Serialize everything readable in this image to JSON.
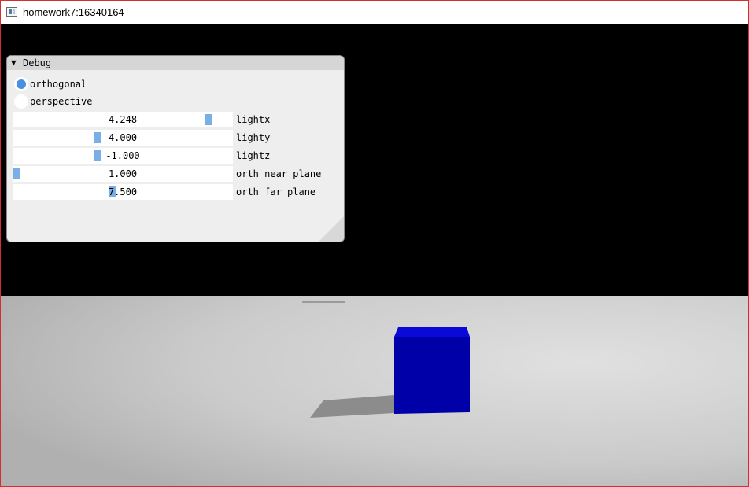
{
  "window": {
    "title": "homework7:16340164"
  },
  "debug": {
    "title": "Debug",
    "projection": {
      "options": [
        {
          "label": "orthogonal",
          "selected": true
        },
        {
          "label": "perspective",
          "selected": false
        }
      ]
    },
    "sliders": [
      {
        "label": "lightx",
        "value": "4.248",
        "fraction": 0.9
      },
      {
        "label": "lighty",
        "value": "4.000",
        "fraction": 0.38
      },
      {
        "label": "lightz",
        "value": "-1.000",
        "fraction": 0.38
      },
      {
        "label": "orth_near_plane",
        "value": "1.000",
        "fraction": 0.0
      },
      {
        "label": "orth_far_plane",
        "value": "7.500",
        "fraction": 0.45
      }
    ]
  },
  "scene": {
    "cube_color": "#0000a8",
    "cube_top_color": "#0a0ad8",
    "floor_color": "#cdcdcd",
    "shadow_color": "#8c8c8c",
    "background_color": "#000000"
  }
}
